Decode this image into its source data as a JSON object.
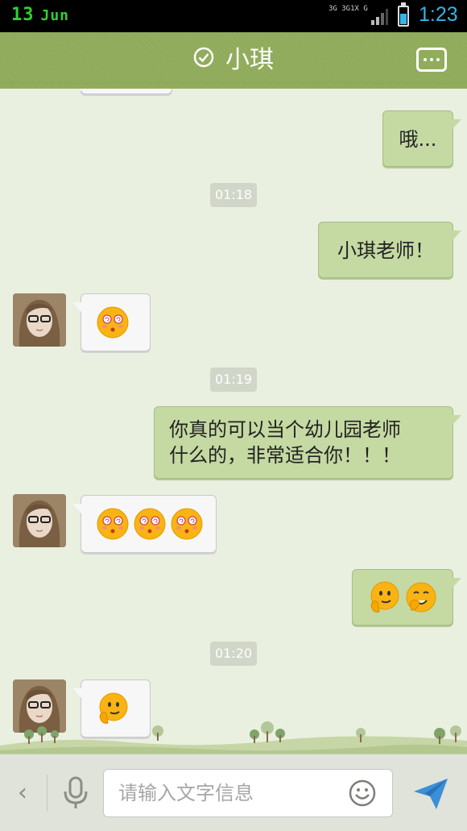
{
  "status_bar": {
    "date_day": "13",
    "date_month": "Jun",
    "network_left": "3G",
    "network_right": "3G1X",
    "network_g": "G",
    "time": "1:23",
    "battery_level": 0.6
  },
  "header": {
    "title": "小琪",
    "status_icon": "check-circle-icon",
    "menu_icon": "more-dots-icon"
  },
  "messages": [
    {
      "type": "out",
      "text": "哦..."
    },
    {
      "type": "time",
      "text": "01:18"
    },
    {
      "type": "out",
      "text": "小琪老师！"
    },
    {
      "type": "in",
      "emojis": [
        "dizzy-emoji"
      ]
    },
    {
      "type": "time",
      "text": "01:19"
    },
    {
      "type": "out",
      "line1": "你真的可以当个幼儿园老师",
      "line2": "什么的，非常适合你！！！"
    },
    {
      "type": "in",
      "emojis": [
        "dizzy-emoji",
        "dizzy-emoji",
        "dizzy-emoji"
      ]
    },
    {
      "type": "out",
      "emojis": [
        "thinking-emoji",
        "shy-giggle-emoji"
      ]
    },
    {
      "type": "time",
      "text": "01:20"
    },
    {
      "type": "in",
      "emojis": [
        "thinking-emoji"
      ]
    }
  ],
  "input_bar": {
    "placeholder": "请输入文字信息",
    "back_icon": "chevron-left-icon",
    "voice_icon": "microphone-icon",
    "emoji_icon": "smiley-icon",
    "send_icon": "send-icon"
  },
  "colors": {
    "header_green": "#8faa5a",
    "chat_background": "#e9f0df",
    "outgoing_bubble": "#c5d9a3",
    "incoming_bubble": "#f7f7f7",
    "time_accent": "#33b5e5"
  }
}
